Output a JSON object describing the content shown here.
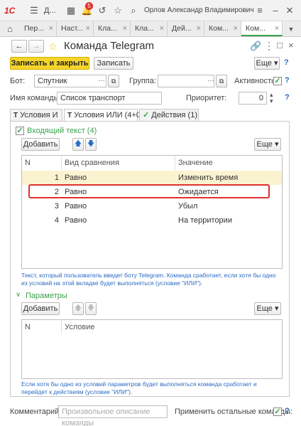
{
  "topbar": {
    "logo": "1С",
    "title": "Д...",
    "notification_count": "5",
    "user": "Орлов Александр Владимирович"
  },
  "page_tabs": [
    "Пер...",
    "Наст...",
    "Кла...",
    "Кла...",
    "Дей...",
    "Ком...",
    "Ком..."
  ],
  "header": {
    "title": "Команда Telegram",
    "more_label": "Еще",
    "help": "?"
  },
  "actions": {
    "save_close_label": "Записать и закрыть",
    "save_label": "Записать"
  },
  "fields": {
    "bot_label": "Бот:",
    "bot_value": "Спутник",
    "group_label": "Группа:",
    "group_value": "",
    "active_label": "Активность:",
    "name_label": "Имя команды:",
    "name_value": "Список транспорт",
    "priority_label": "Приоритет:",
    "priority_value": "0"
  },
  "form_tabs": [
    {
      "label": "Условия И"
    },
    {
      "label": "Условия ИЛИ (4+0)"
    },
    {
      "label": "Действия (1)"
    }
  ],
  "incoming": {
    "section_label": "Входящий текст (4)",
    "add_label": "Добавить",
    "more_label": "Еще",
    "columns": [
      "N",
      "Вид сравнения",
      "Значение"
    ],
    "rows": [
      {
        "n": "1",
        "kind": "Равно",
        "value": "Изменить время"
      },
      {
        "n": "2",
        "kind": "Равно",
        "value": "Ожидается"
      },
      {
        "n": "3",
        "kind": "Равно",
        "value": "Убыл"
      },
      {
        "n": "4",
        "kind": "Равно",
        "value": "На территории"
      }
    ],
    "hint": "Текст, который пользователь введет боту Telegram. Команда сработает, если хотя бы одно из условий на этой вкладке будет выполняться (условие \"ИЛИ\")."
  },
  "params": {
    "section_label": "Параметры",
    "add_label": "Добавить",
    "more_label": "Еще",
    "columns": [
      "N",
      "Условие"
    ],
    "hint": "Если хотя бы одно из условий параметров будет выполняться команда сработает и перейдет к действиям (условие \"ИЛИ\")."
  },
  "footer": {
    "comment_label": "Комментарий:",
    "comment_placeholder": "Произвольное описание команды",
    "apply_other_label": "Применить остальные команды:"
  },
  "colors": {
    "accent": "#3aa14a",
    "primary_button": "#f5d52b",
    "selection": "#fbf3d0",
    "highlight_border": "#e03030",
    "hint": "#2a6ac4"
  }
}
